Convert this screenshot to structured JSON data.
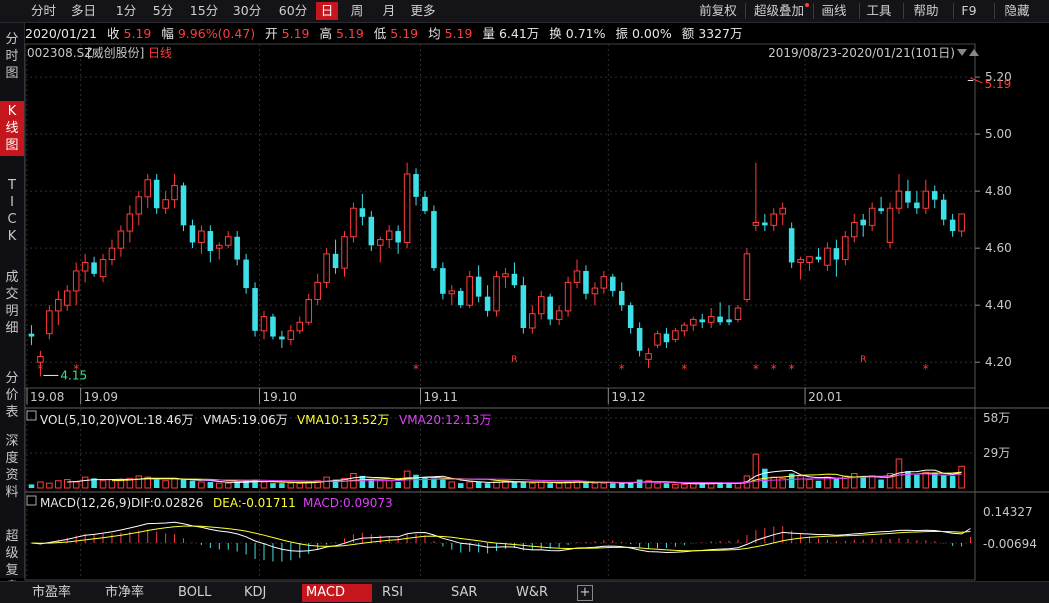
{
  "toolbar": {
    "periods": [
      "分时",
      "多日",
      "1分",
      "5分",
      "15分",
      "30分",
      "60分",
      "日",
      "周",
      "月",
      "更多"
    ],
    "active_period": "日",
    "right": [
      "前复权",
      "超级叠加",
      "画线",
      "工具",
      "帮助",
      "F9",
      "隐藏"
    ]
  },
  "sidebar": {
    "items": [
      "分时图",
      "K线图",
      "TICK",
      "成交明细",
      "分价表",
      "深度资料",
      "超级复盘"
    ],
    "active": "K线图"
  },
  "info": {
    "date": "2020/01/21",
    "close_label": "收",
    "close": "5.19",
    "range_label": "幅",
    "range": "9.96%(0.47)",
    "open_label": "开",
    "open": "5.19",
    "high_label": "高",
    "high": "5.19",
    "low_label": "低",
    "low": "5.19",
    "avg_label": "均",
    "avg": "5.19",
    "vol_label": "量",
    "vol": "6.41万",
    "turnover_label": "换",
    "turnover": "0.71%",
    "amplitude_label": "振",
    "amplitude": "0.00%",
    "amount_label": "额",
    "amount": "3327万"
  },
  "colors": {
    "up": "#ff3c3c",
    "down": "#3ee0e8",
    "ma5": "#ffffff",
    "ma10": "#ffff33",
    "ma20": "#e040fb",
    "grid": "#2e2e36",
    "axis": "#444"
  },
  "chart_data": {
    "type": "candlestick",
    "stock_code": "002308.SZ",
    "stock_name": "[威创股份]",
    "period_label": "日线",
    "range_label": "2019/08/23-2020/01/21(101日)",
    "y_ticks": [
      "5.20",
      "5.00",
      "4.80",
      "4.60",
      "4.40",
      "4.20"
    ],
    "ylim": [
      4.12,
      5.26
    ],
    "x_ticks": [
      {
        "label": "19.08",
        "index": 0
      },
      {
        "label": "19.09",
        "index": 6
      },
      {
        "label": "19.10",
        "index": 26
      },
      {
        "label": "19.11",
        "index": 44
      },
      {
        "label": "19.12",
        "index": 65
      },
      {
        "label": "20.01",
        "index": 87
      }
    ],
    "max_annotation": "5.19",
    "min_annotation": "4.15",
    "markers": [
      {
        "index": 1,
        "sym": "*"
      },
      {
        "index": 5,
        "sym": "*"
      },
      {
        "index": 43,
        "sym": "*"
      },
      {
        "index": 54,
        "sym": "R"
      },
      {
        "index": 66,
        "sym": "*"
      },
      {
        "index": 73,
        "sym": "*"
      },
      {
        "index": 81,
        "sym": "*"
      },
      {
        "index": 83,
        "sym": "*"
      },
      {
        "index": 85,
        "sym": "*"
      },
      {
        "index": 93,
        "sym": "R"
      },
      {
        "index": 100,
        "sym": "*"
      }
    ],
    "ohlc": [
      [
        4.3,
        4.33,
        4.26,
        4.29
      ],
      [
        4.2,
        4.24,
        4.15,
        4.22
      ],
      [
        4.3,
        4.4,
        4.28,
        4.38
      ],
      [
        4.38,
        4.45,
        4.33,
        4.42
      ],
      [
        4.4,
        4.47,
        4.38,
        4.45
      ],
      [
        4.45,
        4.55,
        4.4,
        4.52
      ],
      [
        4.52,
        4.58,
        4.48,
        4.55
      ],
      [
        4.55,
        4.57,
        4.5,
        4.51
      ],
      [
        4.5,
        4.58,
        4.48,
        4.56
      ],
      [
        4.56,
        4.63,
        4.54,
        4.6
      ],
      [
        4.6,
        4.68,
        4.57,
        4.66
      ],
      [
        4.66,
        4.75,
        4.62,
        4.72
      ],
      [
        4.72,
        4.8,
        4.68,
        4.78
      ],
      [
        4.78,
        4.86,
        4.74,
        4.84
      ],
      [
        4.84,
        4.86,
        4.72,
        4.74
      ],
      [
        4.74,
        4.8,
        4.72,
        4.77
      ],
      [
        4.77,
        4.86,
        4.74,
        4.82
      ],
      [
        4.82,
        4.83,
        4.66,
        4.68
      ],
      [
        4.68,
        4.7,
        4.6,
        4.62
      ],
      [
        4.62,
        4.68,
        4.58,
        4.66
      ],
      [
        4.66,
        4.68,
        4.55,
        4.59
      ],
      [
        4.6,
        4.62,
        4.56,
        4.61
      ],
      [
        4.61,
        4.66,
        4.6,
        4.64
      ],
      [
        4.64,
        4.66,
        4.54,
        4.56
      ],
      [
        4.56,
        4.58,
        4.44,
        4.46
      ],
      [
        4.46,
        4.48,
        4.29,
        4.31
      ],
      [
        4.31,
        4.38,
        4.28,
        4.36
      ],
      [
        4.36,
        4.37,
        4.28,
        4.29
      ],
      [
        4.29,
        4.31,
        4.25,
        4.28
      ],
      [
        4.28,
        4.33,
        4.26,
        4.31
      ],
      [
        4.31,
        4.36,
        4.3,
        4.34
      ],
      [
        4.34,
        4.44,
        4.33,
        4.42
      ],
      [
        4.42,
        4.51,
        4.4,
        4.48
      ],
      [
        4.48,
        4.6,
        4.46,
        4.58
      ],
      [
        4.58,
        4.63,
        4.51,
        4.53
      ],
      [
        4.53,
        4.66,
        4.5,
        4.64
      ],
      [
        4.64,
        4.76,
        4.62,
        4.74
      ],
      [
        4.74,
        4.79,
        4.68,
        4.71
      ],
      [
        4.71,
        4.73,
        4.59,
        4.61
      ],
      [
        4.61,
        4.64,
        4.55,
        4.63
      ],
      [
        4.63,
        4.68,
        4.6,
        4.66
      ],
      [
        4.66,
        4.68,
        4.58,
        4.62
      ],
      [
        4.62,
        4.9,
        4.6,
        4.86
      ],
      [
        4.86,
        4.88,
        4.75,
        4.78
      ],
      [
        4.78,
        4.8,
        4.72,
        4.73
      ],
      [
        4.73,
        4.75,
        4.52,
        4.53
      ],
      [
        4.53,
        4.55,
        4.42,
        4.44
      ],
      [
        4.44,
        4.47,
        4.4,
        4.45
      ],
      [
        4.45,
        4.46,
        4.39,
        4.4
      ],
      [
        4.4,
        4.52,
        4.39,
        4.5
      ],
      [
        4.5,
        4.54,
        4.41,
        4.43
      ],
      [
        4.43,
        4.47,
        4.36,
        4.38
      ],
      [
        4.38,
        4.52,
        4.36,
        4.5
      ],
      [
        4.5,
        4.53,
        4.46,
        4.51
      ],
      [
        4.51,
        4.55,
        4.46,
        4.47
      ],
      [
        4.47,
        4.5,
        4.3,
        4.32
      ],
      [
        4.32,
        4.4,
        4.3,
        4.37
      ],
      [
        4.37,
        4.45,
        4.35,
        4.43
      ],
      [
        4.43,
        4.44,
        4.33,
        4.35
      ],
      [
        4.35,
        4.4,
        4.33,
        4.38
      ],
      [
        4.38,
        4.5,
        4.36,
        4.48
      ],
      [
        4.48,
        4.56,
        4.46,
        4.52
      ],
      [
        4.52,
        4.54,
        4.42,
        4.44
      ],
      [
        4.44,
        4.48,
        4.4,
        4.46
      ],
      [
        4.46,
        4.52,
        4.44,
        4.5
      ],
      [
        4.5,
        4.51,
        4.43,
        4.45
      ],
      [
        4.45,
        4.48,
        4.38,
        4.4
      ],
      [
        4.4,
        4.41,
        4.3,
        4.32
      ],
      [
        4.32,
        4.34,
        4.22,
        4.24
      ],
      [
        4.21,
        4.25,
        4.18,
        4.23
      ],
      [
        4.26,
        4.31,
        4.25,
        4.3
      ],
      [
        4.3,
        4.32,
        4.25,
        4.27
      ],
      [
        4.28,
        4.32,
        4.27,
        4.31
      ],
      [
        4.31,
        4.34,
        4.29,
        4.33
      ],
      [
        4.33,
        4.36,
        4.31,
        4.35
      ],
      [
        4.35,
        4.37,
        4.32,
        4.34
      ],
      [
        4.34,
        4.39,
        4.32,
        4.36
      ],
      [
        4.36,
        4.41,
        4.33,
        4.34
      ],
      [
        4.35,
        4.4,
        4.33,
        4.34
      ],
      [
        4.35,
        4.4,
        4.34,
        4.39
      ],
      [
        4.42,
        4.6,
        4.41,
        4.58
      ],
      [
        4.68,
        4.9,
        4.66,
        4.69
      ],
      [
        4.69,
        4.72,
        4.66,
        4.68
      ],
      [
        4.68,
        4.74,
        4.66,
        4.72
      ],
      [
        4.72,
        4.76,
        4.68,
        4.74
      ],
      [
        4.67,
        4.69,
        4.53,
        4.55
      ],
      [
        4.55,
        4.57,
        4.49,
        4.56
      ],
      [
        4.55,
        4.57,
        4.52,
        4.57
      ],
      [
        4.57,
        4.6,
        4.55,
        4.56
      ],
      [
        4.54,
        4.62,
        4.52,
        4.6
      ],
      [
        4.6,
        4.63,
        4.5,
        4.56
      ],
      [
        4.56,
        4.66,
        4.54,
        4.64
      ],
      [
        4.64,
        4.72,
        4.62,
        4.69
      ],
      [
        4.7,
        4.72,
        4.64,
        4.68
      ],
      [
        4.68,
        4.76,
        4.66,
        4.74
      ],
      [
        4.74,
        4.78,
        4.72,
        4.73
      ],
      [
        4.62,
        4.76,
        4.6,
        4.74
      ],
      [
        4.74,
        4.86,
        4.72,
        4.8
      ],
      [
        4.8,
        4.84,
        4.74,
        4.76
      ],
      [
        4.76,
        4.8,
        4.72,
        4.74
      ],
      [
        4.74,
        4.84,
        4.72,
        4.8
      ],
      [
        4.8,
        4.82,
        4.74,
        4.77
      ],
      [
        4.77,
        4.79,
        4.68,
        4.7
      ],
      [
        4.7,
        4.72,
        4.64,
        4.66
      ],
      [
        4.66,
        4.72,
        4.64,
        4.72
      ],
      [
        5.19,
        5.19,
        5.19,
        5.19
      ]
    ],
    "volume_panel": {
      "label_prefix": "VOL(5,10,20)",
      "vol": "VOL:18.46万",
      "vma5": "VMA5:19.06万",
      "vma10": "VMA10:13.52万",
      "vma20": "VMA20:12.13万",
      "y_ticks": [
        "58万",
        "29万"
      ],
      "ylim": [
        0,
        58
      ],
      "values": [
        3,
        5,
        4,
        6,
        7,
        5,
        9,
        8,
        6,
        7,
        6,
        8,
        10,
        9,
        7,
        6,
        8,
        7,
        6,
        5,
        5,
        4,
        4,
        5,
        6,
        7,
        5,
        4,
        4,
        4,
        4,
        5,
        6,
        9,
        7,
        8,
        12,
        10,
        7,
        6,
        6,
        5,
        14,
        11,
        9,
        8,
        7,
        5,
        4,
        5,
        5,
        4,
        5,
        6,
        5,
        5,
        4,
        5,
        4,
        4,
        5,
        6,
        5,
        4,
        4,
        4,
        4,
        5,
        7,
        6,
        4,
        4,
        3,
        3,
        4,
        4,
        4,
        4,
        4,
        4,
        10,
        28,
        16,
        9,
        8,
        12,
        10,
        7,
        6,
        9,
        8,
        10,
        12,
        9,
        10,
        7,
        12,
        24,
        14,
        11,
        13,
        12,
        11,
        10,
        18
      ]
    },
    "macd_panel": {
      "label_prefix": "MACD(12,26,9)",
      "dif": "DIF:0.02826",
      "dea": "DEA:-0.01711",
      "macd": "MACD:0.09073",
      "y_ticks": [
        "0.14327",
        "-0.00694"
      ]
    }
  },
  "bottom_tabs": [
    "市盈率",
    "市净率",
    "BOLL",
    "KDJ",
    "MACD",
    "RSI",
    "SAR",
    "W&R"
  ],
  "active_bottom_tab": "MACD"
}
